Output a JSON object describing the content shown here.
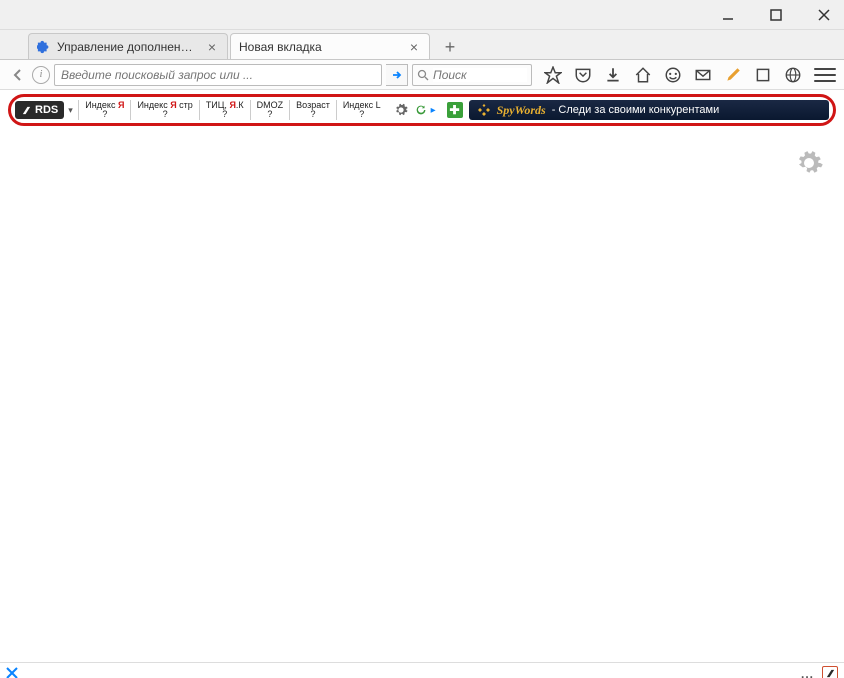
{
  "window": {
    "controls": {
      "min": "minimize",
      "max": "maximize",
      "close": "close"
    }
  },
  "tabs": [
    {
      "label": "Управление дополнениями..."
    },
    {
      "label": "Новая вкладка"
    }
  ],
  "new_tab": "+",
  "nav": {
    "url_placeholder": "Введите поисковый запрос или ...",
    "search_placeholder": "Поиск"
  },
  "rds": {
    "logo": "RDS",
    "stats": [
      {
        "label_pre": "Индекс ",
        "label_ya": "Я",
        "label_post": "",
        "val": "?"
      },
      {
        "label_pre": "Индекс ",
        "label_ya": "Я",
        "label_post": " стр",
        "val": "?"
      },
      {
        "label_pre": "ТИЦ, ",
        "label_ya": "Я",
        "label_post": ".К",
        "val": "?"
      },
      {
        "label_pre": "DMOZ",
        "label_ya": "",
        "label_post": "",
        "val": "?"
      },
      {
        "label_pre": "Возраст",
        "label_ya": "",
        "label_post": "",
        "val": "?"
      },
      {
        "label_pre": "Индекс L",
        "label_ya": "",
        "label_post": "",
        "val": "?"
      }
    ],
    "spy": {
      "brand": "SpyWords",
      "text": " -  Следи за своими конкурентами"
    }
  },
  "status": {
    "dots": "..."
  }
}
